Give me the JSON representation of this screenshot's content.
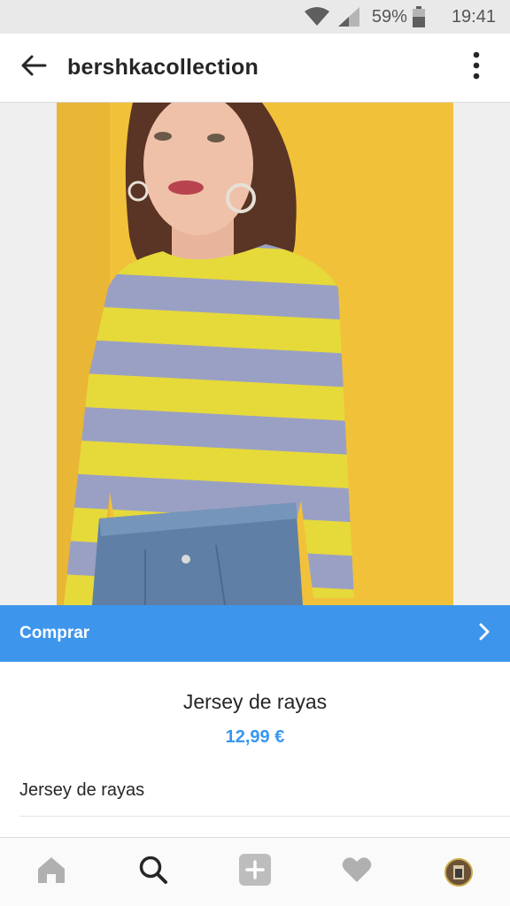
{
  "status_bar": {
    "battery": "59%",
    "time": "19:41",
    "icons": [
      "wifi-icon",
      "signal-icon",
      "battery-icon"
    ]
  },
  "header": {
    "title": "bershkacollection",
    "back_icon": "arrow-left-icon",
    "more_icon": "vertical-dots-icon"
  },
  "product_image": {
    "description_icon": "product-photo"
  },
  "shop_bar": {
    "label": "Comprar",
    "icon": "chevron-right-icon",
    "color": "#3d96ec"
  },
  "product": {
    "name": "Jersey de rayas",
    "price": "12,99 €",
    "description": "Jersey de rayas",
    "price_color": "#3897f0"
  },
  "bottom_nav": {
    "items": [
      {
        "name": "home",
        "icon": "home-icon"
      },
      {
        "name": "search",
        "icon": "search-icon",
        "active": true
      },
      {
        "name": "add",
        "icon": "plus-box-icon"
      },
      {
        "name": "activity",
        "icon": "heart-icon"
      },
      {
        "name": "profile",
        "icon": "avatar"
      }
    ]
  }
}
